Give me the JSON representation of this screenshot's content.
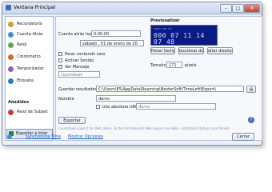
{
  "window": {
    "title": "Ventana Principal"
  },
  "sidebar": {
    "items": [
      {
        "label": "Recordatorio",
        "color": "#c9a227"
      },
      {
        "label": "Cuenta Atrás",
        "color": "#3b8fd8"
      },
      {
        "label": "Reloj",
        "color": "#5aa55a"
      },
      {
        "label": "Cronómetro",
        "color": "#d06a2c"
      },
      {
        "label": "Temporizador",
        "color": "#8a5fc2"
      },
      {
        "label": "Etiqueta",
        "color": "#2b7fbf"
      }
    ],
    "section_label": "Añadidos",
    "addon_item": {
      "label": "Reloj de Subast",
      "color": "#c43d3d"
    },
    "export_label": "Exportar a Inter"
  },
  "countdown": {
    "label": "Cuenta atrás has",
    "time_value": "0:00:00",
    "date_day": "sábado",
    "date_num": "01",
    "date_sep": "de",
    "date_month": "enero",
    "date_sep2": "de",
    "date_year": "20"
  },
  "options": {
    "stop_zero": "Parar contando cero",
    "sound": "Activar Sonido",
    "message": "Ver Mensaje",
    "message_value": "countdown"
  },
  "preview": {
    "title": "Previsualizar",
    "header": "HOURS MIN SEC",
    "digits": "000 07 11 14 07 48",
    "set_time": "Poner tiempo...",
    "select_design": "leccionar dise",
    "edit_design": "ditar diseño..."
  },
  "size": {
    "label": "Tamaño",
    "value": "171",
    "unit": "pixels"
  },
  "export": {
    "save_label": "Guardar resultados e",
    "path": "C:\\Users\\ES\\AppData\\Roaming\\NesterSoft\\TimeLeft\\Export\\",
    "name_label": "Nombre",
    "name_value": "demo",
    "absolute_label": "Use absolute URL",
    "absolute_value": "demo",
    "button": "Exportar",
    "note": "Countdown Export for Web demo. To the full-featured Web Export see Help - Additional Options and Panels"
  },
  "footer": {
    "sync": "Synchronize Time",
    "options": "Mostrar Opciones",
    "close": "Cerrar"
  }
}
